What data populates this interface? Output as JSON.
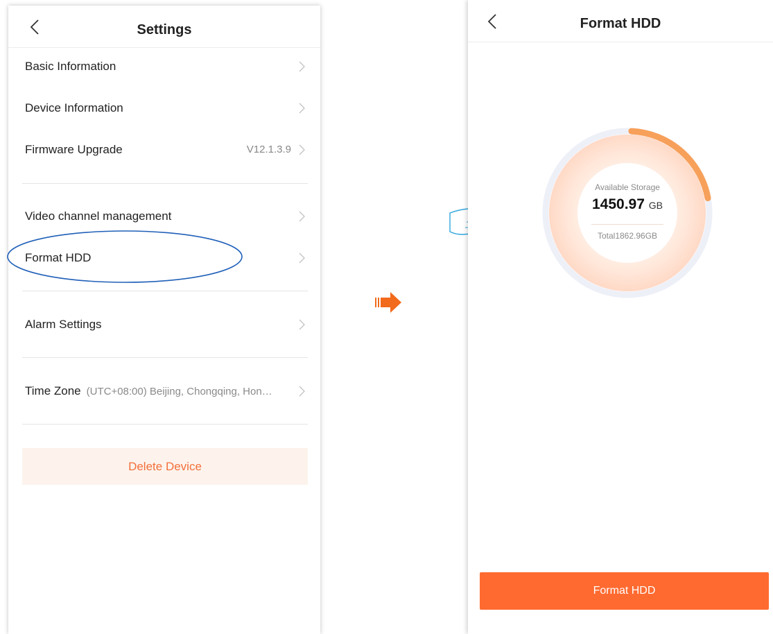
{
  "left_screen": {
    "title": "Settings",
    "items": [
      {
        "label": "Basic Information",
        "value": ""
      },
      {
        "label": "Device Information",
        "value": ""
      },
      {
        "label": "Firmware Upgrade",
        "value": "V12.1.3.9"
      },
      {
        "label": "Video channel management",
        "value": ""
      },
      {
        "label": "Format HDD",
        "value": ""
      },
      {
        "label": "Alarm Settings",
        "value": ""
      },
      {
        "label": "Time Zone",
        "value": "(UTC+08:00) Beijing, Chongqing, Hon…"
      }
    ],
    "delete_label": "Delete Device"
  },
  "right_screen": {
    "title": "Format HDD",
    "storage": {
      "available_label": "Available Storage",
      "available_value": "1450.97",
      "unit": "GB",
      "total_label": "Total1862.96GB",
      "used_fraction": 0.221
    },
    "button_label": "Format HDD"
  },
  "colors": {
    "accent": "#ff6a30",
    "annotation_blue": "#1f5fb8",
    "hand_blue": "#2fa6dd",
    "gauge_track": "#eef0f8",
    "gauge_arc": "#f7a05a"
  },
  "icons": {
    "back": "chevron-left-icon",
    "chevron": "chevron-right-icon",
    "arrow": "arrow-right-icon",
    "hand": "pointing-hand-icon"
  }
}
